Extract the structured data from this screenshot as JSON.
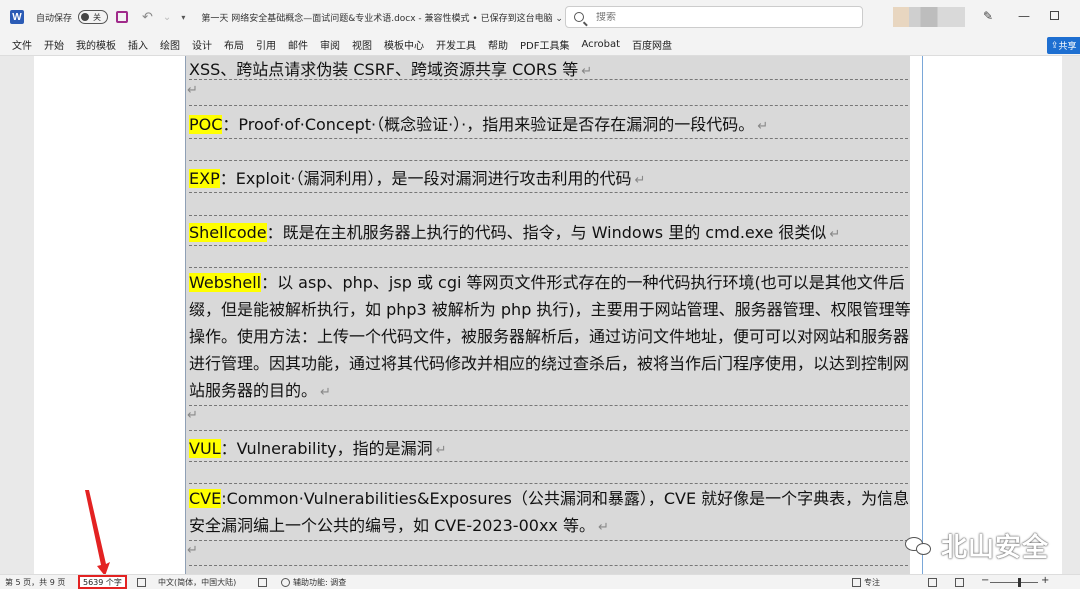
{
  "titlebar": {
    "app_logo": "W",
    "autosave_label": "自动保存",
    "autosave_state": "关",
    "doc_title": "第一天 网络安全基础概念—面试问题&专业术语.docx  -  兼容性模式 • 已保存到这台电脑 ⌄",
    "search_placeholder": "搜索",
    "icons": [
      "word-logo-icon",
      "save-icon",
      "undo-icon",
      "redo-icon",
      "pen-icon",
      "minimize-icon",
      "maximize-icon",
      "search-icon"
    ]
  },
  "ribbon": {
    "tabs": [
      "文件",
      "开始",
      "我的模板",
      "插入",
      "绘图",
      "设计",
      "布局",
      "引用",
      "邮件",
      "审阅",
      "视图",
      "模板中心",
      "开发工具",
      "帮助",
      "PDF工具集",
      "Acrobat",
      "百度网盘"
    ],
    "share_label": "共享"
  },
  "document": {
    "rows": [
      {
        "rest": "XSS、跨站点请求伪装 CSRF、跨域资源共享 CORS 等",
        "mark": "↵"
      },
      {
        "empty": "↵"
      },
      {
        "term": "POC",
        "rest": "：Proof·of·Concept·（概念验证·）·，指用来验证是否存在漏洞的一段代码。",
        "mark": "↵"
      },
      {
        "term": "EXP",
        "rest": "：Exploit·（漏洞利用），是一段对漏洞进行攻击利用的代码",
        "mark": "↵"
      },
      {
        "term": "Shellcode",
        "rest": "：既是在主机服务器上执行的代码、指令，与 Windows 里的 cmd.exe 很类似",
        "mark": "↵"
      },
      {
        "term": "Webshell",
        "rest": "：以 asp、php、jsp 或 cgi 等网页文件形式存在的一种代码执行环境(也可以是其他文件后缀，但是能被解析执行，如 php3 被解析为 php 执行)，主要用于网站管理、服务器管理、权限管理等操作。使用方法：上传一个代码文件，被服务器解析后，通过访问文件地址，便可可以对网站和服务器进行管理。因其功能，通过将其代码修改并相应的绕过查杀后，被将当作后门程序使用，以达到控制网站服务器的目的。",
        "mark": "↵"
      },
      {
        "empty": "↵"
      },
      {
        "term": "VUL",
        "rest": "：Vulnerability，指的是漏洞",
        "mark": "↵"
      },
      {
        "term": "CVE",
        "rest": ":Common·Vulnerabilities&Exposures（公共漏洞和暴露），CVE 就好像是一个字典表，为信息安全漏洞编上一个公共的编号，如 CVE-2023-00xx 等。",
        "mark": "↵"
      },
      {
        "empty": "↵"
      }
    ]
  },
  "watermark": {
    "text": "北山安全"
  },
  "statusbar": {
    "page_info": "第 5 页，共 9 页",
    "word_count": "5639 个字",
    "language": "中文(简体，中国大陆)",
    "accessibility": "辅助功能: 调查",
    "focus": "专注"
  },
  "colors": {
    "highlight": "#ffff00",
    "annotation": "#e32222",
    "share": "#1e6fd1"
  }
}
